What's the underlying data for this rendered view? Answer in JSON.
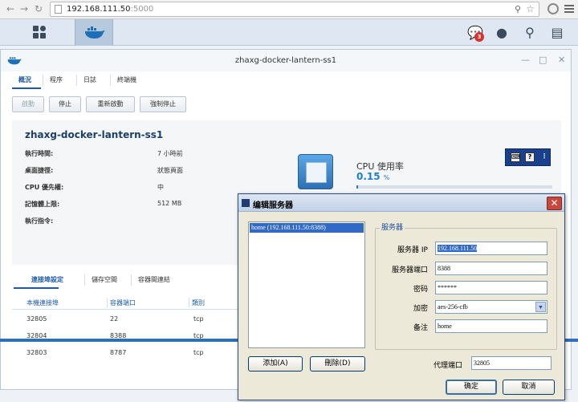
{
  "browser": {
    "url_host": "192.168.111.50",
    "url_port": ":5000"
  },
  "taskbar": {
    "notification_count": "3"
  },
  "window": {
    "title": "zhaxg-docker-lantern-ss1",
    "tabs": [
      "概況",
      "程序",
      "日誌",
      "終端機"
    ],
    "toolbar": [
      "啟動",
      "停止",
      "重新啟動",
      "強制停止"
    ]
  },
  "overview": {
    "container_name": "zhaxg-docker-lantern-ss1",
    "properties": [
      {
        "label": "執行時間:",
        "value": "7 小時前"
      },
      {
        "label": "桌面捷徑:",
        "value": "狀態頁面"
      },
      {
        "label": "CPU 優先權:",
        "value": "中"
      },
      {
        "label": "記憶體上限:",
        "value": "512 MB"
      },
      {
        "label": "執行指令:",
        "value": ""
      }
    ],
    "cpu_title": "CPU 使用率",
    "cpu_value": "0.15",
    "cpu_unit": "%",
    "cpu_fraction": 0.0015
  },
  "ports": {
    "tabs": [
      "連接埠設定",
      "儲存空間",
      "容器間連結"
    ],
    "columns": [
      "本機連接埠",
      "容器端口",
      "類別"
    ],
    "rows": [
      [
        "32805",
        "22",
        "tcp"
      ],
      [
        "32804",
        "8388",
        "tcp"
      ],
      [
        "32803",
        "8787",
        "tcp"
      ]
    ]
  },
  "dialog": {
    "title": "编辑服务器",
    "server_list": [
      "home (192.168.111.50:8388)"
    ],
    "group_title": "服务器",
    "fields": {
      "ip_label": "服务器 IP",
      "ip_value": "192.168.111.50",
      "port_label": "服务器端口",
      "port_value": "8388",
      "password_label": "密码",
      "password_value": "******",
      "encryption_label": "加密",
      "encryption_value": "aes-256-cfb",
      "remark_label": "备注",
      "remark_value": "home"
    },
    "proxy_port_label": "代理端口",
    "proxy_port_value": "32805",
    "add_button": "添加(A)",
    "delete_button": "刪除(D)",
    "ok_button": "确定",
    "cancel_button": "取消"
  }
}
